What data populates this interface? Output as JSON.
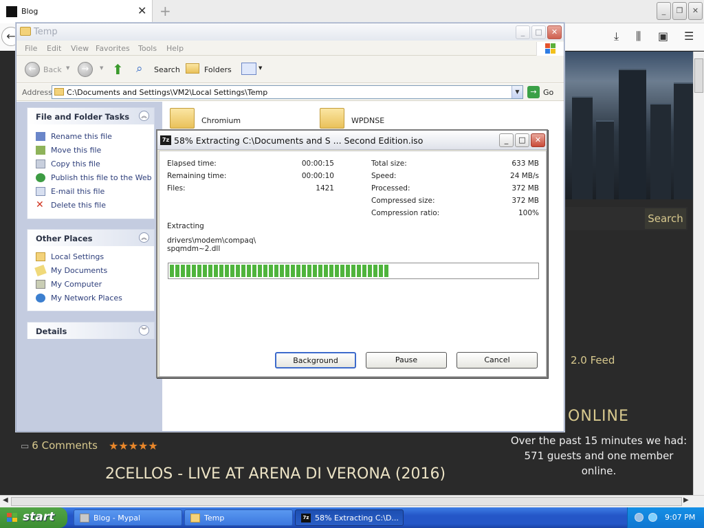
{
  "browser": {
    "tab_label": "Blog",
    "tab_close": "✕",
    "new_tab": "+",
    "page": {
      "search_button": "Search",
      "feed_label": "2.0 Feed",
      "online_title": "ONLINE",
      "online_text": "Over the past 15 minutes we had: 571 guests and one member online.",
      "comments_label": "6 Comments",
      "rating_stars": "★★★★★",
      "post_title": "2CELLOS - LIVE AT ARENA DI VERONA (2016)"
    }
  },
  "explorer": {
    "title": "Temp",
    "menu": [
      "File",
      "Edit",
      "View",
      "Favorites",
      "Tools",
      "Help"
    ],
    "toolbar": {
      "back": "Back",
      "search": "Search",
      "folders": "Folders"
    },
    "address_label": "Address",
    "address_value": "C:\\Documents and Settings\\VM2\\Local Settings\\Temp",
    "go_label": "Go",
    "file_tasks": {
      "header": "File and Folder Tasks",
      "items": [
        "Rename this file",
        "Move this file",
        "Copy this file",
        "Publish this file to the Web",
        "E-mail this file",
        "Delete this file"
      ]
    },
    "other_places": {
      "header": "Other Places",
      "items": [
        "Local Settings",
        "My Documents",
        "My Computer",
        "My Network Places"
      ]
    },
    "details": {
      "header": "Details"
    },
    "folders": [
      "Chromium",
      "WPDNSE"
    ]
  },
  "extract_dialog": {
    "title": "58% Extracting C:\\Documents and S ... Second Edition.iso",
    "elapsed_label": "Elapsed time:",
    "elapsed_value": "00:00:15",
    "remaining_label": "Remaining time:",
    "remaining_value": "00:00:10",
    "files_label": "Files:",
    "files_value": "1421",
    "total_size_label": "Total size:",
    "total_size_value": "633 MB",
    "speed_label": "Speed:",
    "speed_value": "24 MB/s",
    "processed_label": "Processed:",
    "processed_value": "372 MB",
    "compressed_label": "Compressed size:",
    "compressed_value": "372 MB",
    "ratio_label": "Compression ratio:",
    "ratio_value": "100%",
    "status_label": "Extracting",
    "current_path": "drivers\\modem\\compaq\\",
    "current_file": "spqmdm~2.dll",
    "progress_fraction": 0.6,
    "buttons": {
      "background": "Background",
      "pause": "Pause",
      "cancel": "Cancel"
    }
  },
  "taskbar": {
    "start": "start",
    "tasks": [
      "Blog - Mypal",
      "Temp",
      "58% Extracting C:\\D..."
    ],
    "clock": "9:07 PM"
  }
}
